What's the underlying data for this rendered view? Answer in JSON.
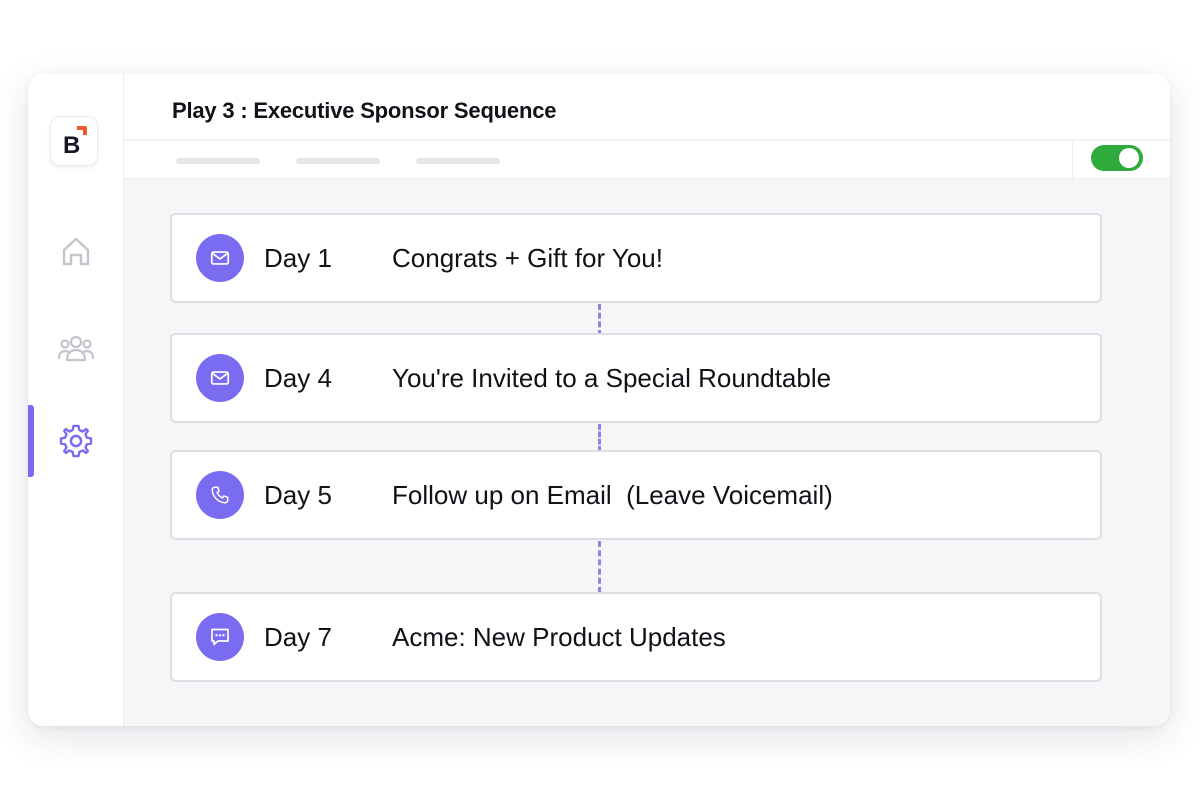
{
  "sidebar": {
    "logo": {
      "letter": "B",
      "accent_color": "#ef5a2a"
    },
    "items": [
      {
        "icon": "home-icon",
        "active": false
      },
      {
        "icon": "users-icon",
        "active": false
      },
      {
        "icon": "gear-icon",
        "active": true
      }
    ]
  },
  "header": {
    "title": "Play 3 : Executive Sponsor Sequence"
  },
  "toggle": {
    "enabled": true,
    "color": "#2eab3c"
  },
  "steps": [
    {
      "day": "Day 1",
      "title": "Congrats + Gift for You!",
      "icon": "mail-icon"
    },
    {
      "day": "Day 4",
      "title": "You're Invited to a Special Roundtable",
      "icon": "mail-icon"
    },
    {
      "day": "Day 5",
      "title": "Follow up on Email  (Leave Voicemail)",
      "icon": "phone-icon"
    },
    {
      "day": "Day 7",
      "title": "Acme: New Product Updates",
      "icon": "message-icon"
    }
  ],
  "colors": {
    "accent": "#7a6cf0",
    "connector": "#8d84e8"
  }
}
